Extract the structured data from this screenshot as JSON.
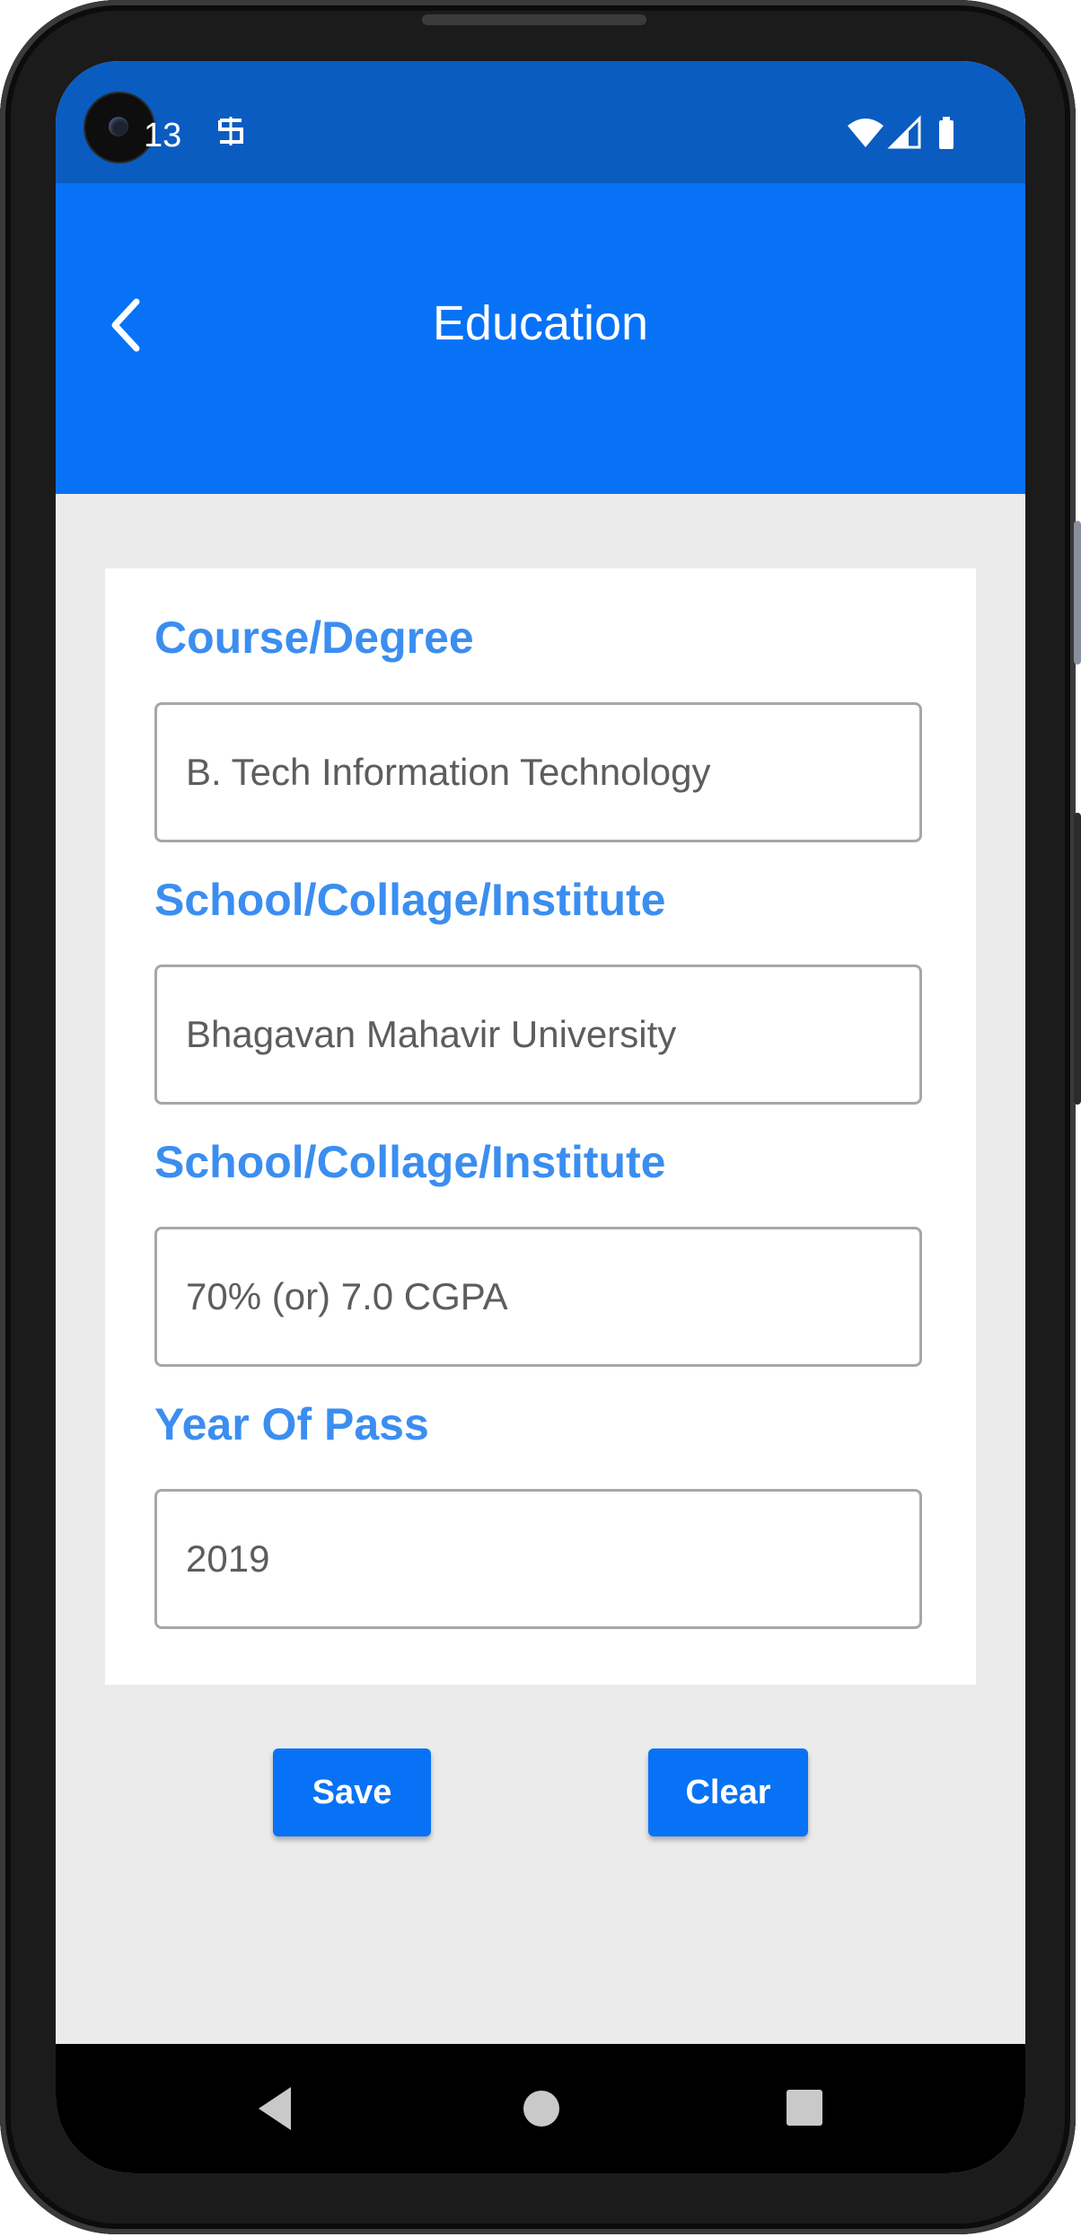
{
  "status_bar": {
    "time": "13",
    "icons": [
      "wifi-icon",
      "cell-signal-icon",
      "battery-icon"
    ]
  },
  "app_bar": {
    "title": "Education",
    "back_icon": "chevron-left-icon",
    "color": "#0872f6"
  },
  "form": {
    "fields": [
      {
        "label": "Course/Degree",
        "value": "B. Tech Information Technology"
      },
      {
        "label": "School/Collage/Institute",
        "value": "Bhagavan Mahavir University"
      },
      {
        "label": "School/Collage/Institute",
        "value": "70% (or) 7.0 CGPA"
      },
      {
        "label": "Year Of Pass",
        "value": "2019"
      }
    ],
    "label_color": "#3b8ef0"
  },
  "actions": {
    "save_label": "Save",
    "clear_label": "Clear"
  },
  "nav_bar": {
    "icons": [
      "back-triangle-icon",
      "home-circle-icon",
      "recents-square-icon"
    ]
  }
}
